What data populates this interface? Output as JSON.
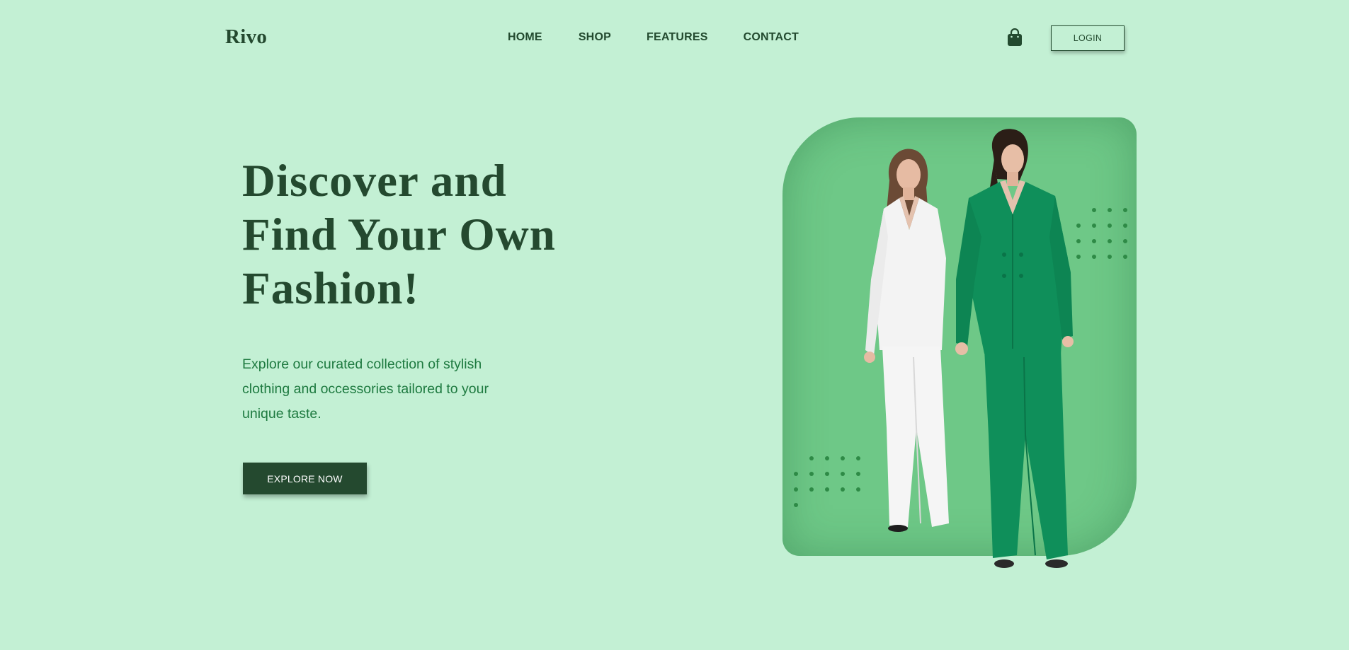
{
  "header": {
    "logo": "Rivo",
    "nav": [
      "HOME",
      "SHOP",
      "FEATURES",
      "CONTACT"
    ],
    "cart_icon": "shopping-bag-icon",
    "login_label": "LOGIN"
  },
  "hero": {
    "title_lines": [
      "Discover and",
      "Find Your Own",
      "Fashion!"
    ],
    "description_lines": [
      "Explore our curated collection of stylish",
      "clothing and occessories tailored to your",
      "unique taste."
    ],
    "cta_label": "EXPLORE NOW",
    "image_subject": "two-models-in-suits"
  },
  "colors": {
    "background": "#c3f0d4",
    "primary": "#24492f",
    "accent_text": "#1e7a40",
    "card": "#6ec887",
    "suit_green": "#0f8f5a",
    "suit_white": "#f2f2f2"
  }
}
